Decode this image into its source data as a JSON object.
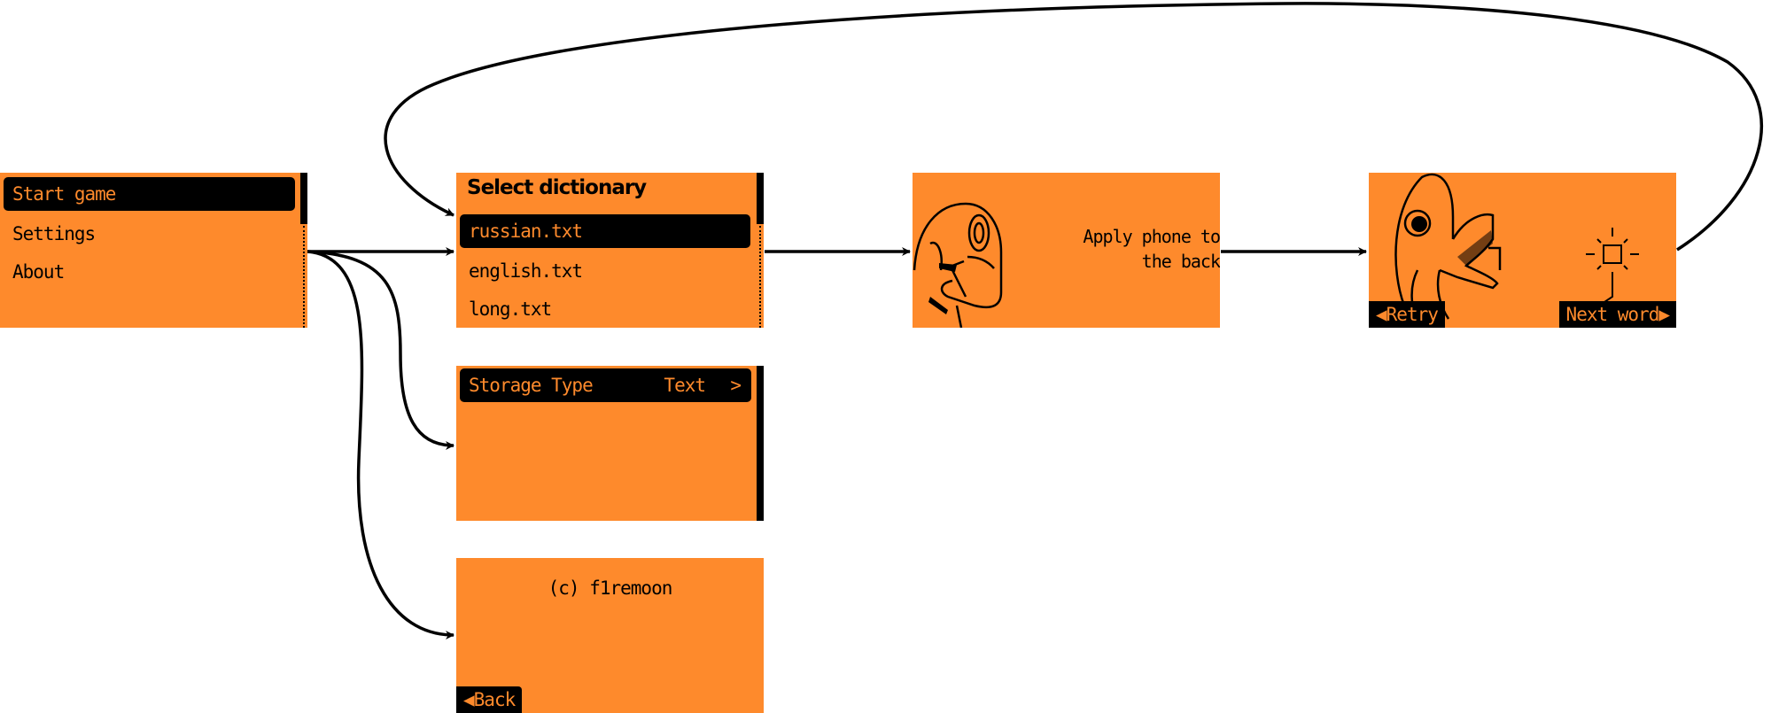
{
  "colors": {
    "screen_bg": "#fe8a2c",
    "ink": "#000000"
  },
  "main_menu": {
    "items": [
      {
        "label": "Start game",
        "selected": true
      },
      {
        "label": "Settings"
      },
      {
        "label": "About"
      }
    ]
  },
  "dictionary": {
    "title": "Select dictionary",
    "items": [
      {
        "label": "russian.txt",
        "selected": true
      },
      {
        "label": "english.txt"
      },
      {
        "label": "long.txt"
      }
    ]
  },
  "settings": {
    "item_label": "Storage Type",
    "item_value": "Text",
    "chevron": ">"
  },
  "about": {
    "text": "(c) f1remoon",
    "back_label": "Back",
    "back_icon": "triangle-left-icon"
  },
  "apply": {
    "line1": "Apply phone to",
    "line2": "the back",
    "image": "dolphin-icon"
  },
  "result": {
    "retry_label": "Retry",
    "next_label": "Next word",
    "image": "dolphin-happy-icon"
  }
}
